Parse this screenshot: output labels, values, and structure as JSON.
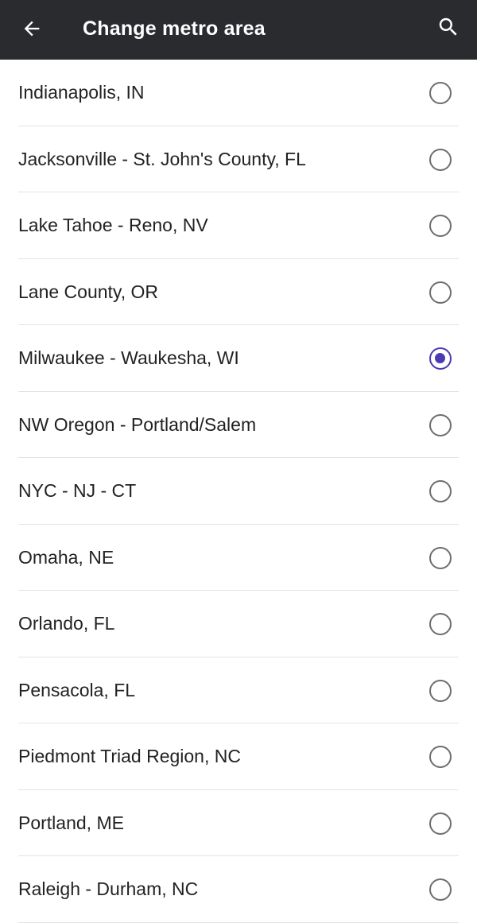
{
  "header": {
    "title": "Change metro area",
    "back_icon": "arrow-back-icon",
    "search_icon": "search-icon"
  },
  "colors": {
    "appbar": "#2a2b2f",
    "radio_selected": "#4a3ab3",
    "radio_unselected": "#6e6e6e"
  },
  "metro_areas": [
    {
      "label": "Indianapolis, IN",
      "selected": false
    },
    {
      "label": "Jacksonville - St. John's County, FL",
      "selected": false
    },
    {
      "label": "Lake Tahoe - Reno, NV",
      "selected": false
    },
    {
      "label": "Lane County, OR",
      "selected": false
    },
    {
      "label": "Milwaukee - Waukesha, WI",
      "selected": true
    },
    {
      "label": "NW Oregon - Portland/Salem",
      "selected": false
    },
    {
      "label": "NYC - NJ - CT",
      "selected": false
    },
    {
      "label": "Omaha, NE",
      "selected": false
    },
    {
      "label": "Orlando, FL",
      "selected": false
    },
    {
      "label": "Pensacola, FL",
      "selected": false
    },
    {
      "label": "Piedmont Triad Region, NC",
      "selected": false
    },
    {
      "label": "Portland, ME",
      "selected": false
    },
    {
      "label": "Raleigh - Durham, NC",
      "selected": false
    }
  ]
}
